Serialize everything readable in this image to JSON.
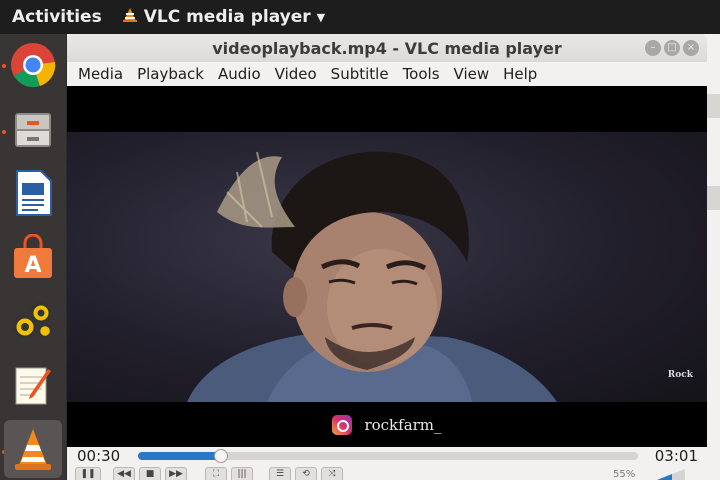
{
  "topbar": {
    "activities": "Activities",
    "app_name": "VLC media player"
  },
  "dock": {
    "items": [
      {
        "name": "chrome",
        "running": true
      },
      {
        "name": "files",
        "running": true
      },
      {
        "name": "writer",
        "running": false
      },
      {
        "name": "software",
        "running": false
      },
      {
        "name": "settings",
        "running": false
      },
      {
        "name": "text-editor",
        "running": false
      },
      {
        "name": "vlc",
        "running": true,
        "active": true
      }
    ]
  },
  "window": {
    "title": "videoplayback.mp4 - VLC media player"
  },
  "menu": [
    "Media",
    "Playback",
    "Audio",
    "Video",
    "Subtitle",
    "Tools",
    "View",
    "Help"
  ],
  "video": {
    "handle": "rockfarm_",
    "watermark": "Rock"
  },
  "playback": {
    "elapsed": "00:30",
    "total": "03:01",
    "progress_fraction": 0.166,
    "volume": "55%"
  },
  "colors": {
    "accent": "#2a79c9",
    "ubuntu_orange": "#e95420"
  }
}
